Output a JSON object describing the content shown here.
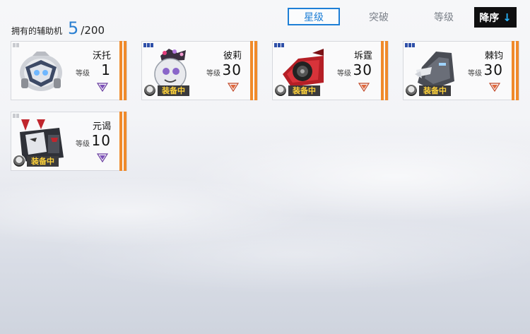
{
  "header": {
    "owned_label": "拥有的辅助机",
    "owned_count": "5",
    "owned_total": "/200"
  },
  "tabs": [
    {
      "label": "星级",
      "active": true
    },
    {
      "label": "突破",
      "active": false
    },
    {
      "label": "等级",
      "active": false
    }
  ],
  "sort": {
    "label": "降序",
    "arrow": "↓"
  },
  "cards": [
    {
      "name": "沃托",
      "level_label": "等级",
      "level": "1",
      "rarity": "gray",
      "equipped": false,
      "equip_label": ""
    },
    {
      "name": "彼莉",
      "level_label": "等级",
      "level": "30",
      "rarity": "blue",
      "equipped": true,
      "equip_label": "装备中"
    },
    {
      "name": "坼霆",
      "level_label": "等级",
      "level": "30",
      "rarity": "blue",
      "equipped": true,
      "equip_label": "装备中"
    },
    {
      "name": "棘钧",
      "level_label": "等级",
      "level": "30",
      "rarity": "blue",
      "equipped": true,
      "equip_label": "装备中"
    },
    {
      "name": "元谒",
      "level_label": "等级",
      "level": "10",
      "rarity": "gray",
      "equipped": true,
      "equip_label": "装备中"
    }
  ],
  "colors": {
    "accent": "#1e7fd6",
    "count": "#2a7fd1",
    "stripe": "#f08a2a",
    "equip_text": "#ffd23a",
    "rarity_blue": "#2e4fa8"
  }
}
